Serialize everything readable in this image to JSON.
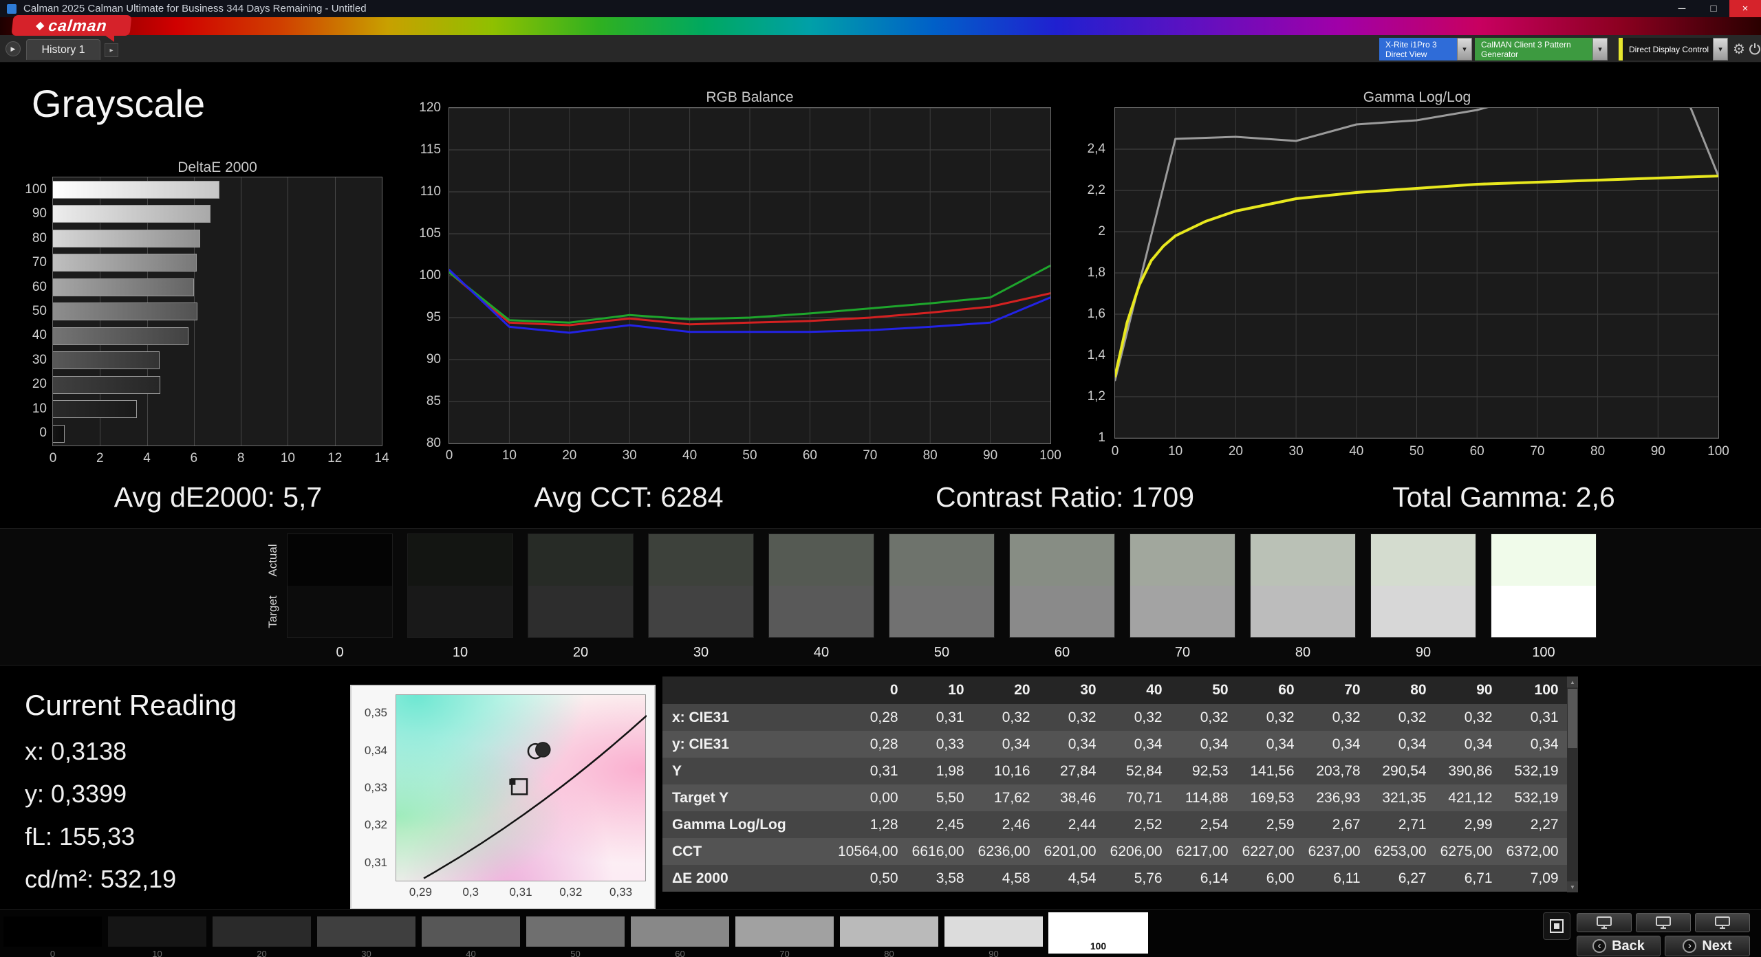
{
  "window": {
    "title": "Calman 2025 Calman Ultimate for Business 344 Days Remaining  - Untitled",
    "minimize": "─",
    "maximize": "□",
    "close": "×"
  },
  "brand": {
    "name": "calman",
    "diamond": "◆"
  },
  "toolbar": {
    "tab": "History 1",
    "meter_line1": "X-Rite i1Pro 3",
    "meter_line2": "Direct View",
    "generator_label": "CalMAN Client 3 Pattern Generator",
    "display_label": "Direct Display Control"
  },
  "page": {
    "title": "Grayscale"
  },
  "stats": {
    "de": "Avg dE2000: 5,7",
    "cct": "Avg CCT: 6284",
    "contrast": "Contrast Ratio: 1709",
    "gamma": "Total Gamma: 2,6"
  },
  "chart_data": [
    {
      "name": "deltae",
      "type": "bar",
      "title": "DeltaE 2000",
      "orientation": "horizontal",
      "categories": [
        100,
        90,
        80,
        70,
        60,
        50,
        40,
        30,
        20,
        10,
        0
      ],
      "values": [
        7.09,
        6.71,
        6.27,
        6.11,
        6.0,
        6.14,
        5.76,
        4.54,
        4.58,
        3.58,
        0.5
      ],
      "xlim": [
        0,
        14
      ],
      "xticks": [
        0,
        2,
        4,
        6,
        8,
        10,
        12,
        14
      ],
      "bar_fills": [
        [
          "#ffffff",
          "#c6c6c6"
        ],
        [
          "#ededed",
          "#a9a9a9"
        ],
        [
          "#d7d7d7",
          "#8f8f8f"
        ],
        [
          "#bfbfbf",
          "#787878"
        ],
        [
          "#a7a7a7",
          "#646464"
        ],
        [
          "#8e8e8e",
          "#525252"
        ],
        [
          "#747474",
          "#424242"
        ],
        [
          "#595959",
          "#333333"
        ],
        [
          "#404040",
          "#262626"
        ],
        [
          "#2a2a2a",
          "#191919"
        ],
        [
          "#151515",
          "#0d0d0d"
        ]
      ]
    },
    {
      "name": "rgb-balance",
      "type": "line",
      "title": "RGB Balance",
      "xlim": [
        0,
        100
      ],
      "xticks": [
        0,
        10,
        20,
        30,
        40,
        50,
        60,
        70,
        80,
        90,
        100
      ],
      "ylim": [
        80,
        120
      ],
      "yticks": [
        80,
        85,
        90,
        95,
        100,
        105,
        110,
        115,
        120
      ],
      "x": [
        0,
        10,
        20,
        30,
        40,
        50,
        60,
        70,
        80,
        90,
        100
      ],
      "series": [
        {
          "name": "Red",
          "color": "#d42121",
          "values": [
            100.4,
            94.4,
            94.1,
            94.9,
            94.2,
            94.4,
            94.6,
            95.0,
            95.6,
            96.3,
            97.9
          ]
        },
        {
          "name": "Green",
          "color": "#1ea62c",
          "values": [
            100.4,
            94.7,
            94.4,
            95.3,
            94.8,
            95.0,
            95.5,
            96.1,
            96.7,
            97.4,
            101.2
          ]
        },
        {
          "name": "Blue",
          "color": "#2323e6",
          "values": [
            100.7,
            93.9,
            93.2,
            94.1,
            93.3,
            93.3,
            93.3,
            93.5,
            93.9,
            94.4,
            97.4
          ]
        }
      ]
    },
    {
      "name": "gamma-loglog",
      "type": "line",
      "title": "Gamma Log/Log",
      "xlim": [
        0,
        100
      ],
      "xticks": [
        0,
        10,
        20,
        30,
        40,
        50,
        60,
        70,
        80,
        90,
        100
      ],
      "ylim": [
        1,
        2.6
      ],
      "ytick_vals": [
        1,
        1.2,
        1.4,
        1.6,
        1.8,
        2,
        2.2,
        2.4
      ],
      "ytick_labels": [
        "1",
        "1,2",
        "1,4",
        "1,6",
        "1,8",
        "2",
        "2,2",
        "2,4"
      ],
      "series": [
        {
          "name": "Measured",
          "color": "#9b9b9b",
          "width": 3,
          "x": [
            0,
            10,
            20,
            30,
            40,
            50,
            60,
            70,
            80,
            90,
            100
          ],
          "values": [
            1.28,
            2.45,
            2.46,
            2.44,
            2.52,
            2.54,
            2.59,
            2.67,
            2.71,
            2.99,
            2.27
          ]
        },
        {
          "name": "Average",
          "color": "#e8e81e",
          "width": 4,
          "x": [
            0,
            2,
            4,
            6,
            8,
            10,
            15,
            20,
            30,
            40,
            50,
            60,
            70,
            80,
            90,
            100
          ],
          "values": [
            1.3,
            1.56,
            1.74,
            1.86,
            1.93,
            1.98,
            2.05,
            2.1,
            2.16,
            2.19,
            2.21,
            2.23,
            2.24,
            2.25,
            2.26,
            2.27
          ]
        }
      ]
    }
  ],
  "swatches": {
    "actual_label": "Actual",
    "target_label": "Target",
    "steps": [
      {
        "label": "0",
        "actual": "#040404",
        "target": "#0c0c0c"
      },
      {
        "label": "10",
        "actual": "#131512",
        "target": "#191919"
      },
      {
        "label": "20",
        "actual": "#272b26",
        "target": "#2d2d2d"
      },
      {
        "label": "30",
        "actual": "#3d413b",
        "target": "#424242"
      },
      {
        "label": "40",
        "actual": "#555a53",
        "target": "#595959"
      },
      {
        "label": "50",
        "actual": "#6e736c",
        "target": "#717171"
      },
      {
        "label": "60",
        "actual": "#878d84",
        "target": "#8a8a8a"
      },
      {
        "label": "70",
        "actual": "#a1a79d",
        "target": "#a3a3a3"
      },
      {
        "label": "80",
        "actual": "#bac1b6",
        "target": "#bcbcbc"
      },
      {
        "label": "90",
        "actual": "#d4dccf",
        "target": "#d7d7d7"
      },
      {
        "label": "100",
        "actual": "#f0fbea",
        "target": "#ffffff"
      }
    ]
  },
  "reading": {
    "title": "Current Reading",
    "lines": [
      "x: 0,3138",
      "y: 0,3399",
      "fL: 155,33",
      "cd/m²: 532,19"
    ]
  },
  "cie": {
    "xrange": [
      0.285,
      0.335
    ],
    "yrange": [
      0.305,
      0.355
    ],
    "xtick_vals": [
      0.29,
      0.3,
      0.31,
      0.32,
      0.33
    ],
    "xtick_labels": [
      "0,29",
      "0,3",
      "0,31",
      "0,32",
      "0,33"
    ],
    "ytick_vals": [
      0.35,
      0.34,
      0.33,
      0.32,
      0.31
    ],
    "ytick_labels": [
      "0,35",
      "0,34",
      "0,33",
      "0,32",
      "0,31"
    ],
    "locus": {
      "start": [
        0.2905,
        0.306
      ],
      "control": [
        0.3135,
        0.3235
      ],
      "end": [
        0.335,
        0.3495
      ]
    },
    "markers": [
      {
        "type": "square-open",
        "x": 0.3096,
        "y": 0.3305
      },
      {
        "type": "square-filled",
        "x": 0.3082,
        "y": 0.3318
      },
      {
        "type": "circle-open",
        "x": 0.3128,
        "y": 0.34
      },
      {
        "type": "circle-filled",
        "x": 0.3143,
        "y": 0.3404
      }
    ]
  },
  "table": {
    "columns": [
      "0",
      "10",
      "20",
      "30",
      "40",
      "50",
      "60",
      "70",
      "80",
      "90",
      "100"
    ],
    "rows": [
      {
        "label": "x: CIE31",
        "values": [
          "0,28",
          "0,31",
          "0,32",
          "0,32",
          "0,32",
          "0,32",
          "0,32",
          "0,32",
          "0,32",
          "0,32",
          "0,31"
        ]
      },
      {
        "label": "y: CIE31",
        "values": [
          "0,28",
          "0,33",
          "0,34",
          "0,34",
          "0,34",
          "0,34",
          "0,34",
          "0,34",
          "0,34",
          "0,34",
          "0,34"
        ]
      },
      {
        "label": "Y",
        "values": [
          "0,31",
          "1,98",
          "10,16",
          "27,84",
          "52,84",
          "92,53",
          "141,56",
          "203,78",
          "290,54",
          "390,86",
          "532,19"
        ]
      },
      {
        "label": "Target Y",
        "values": [
          "0,00",
          "5,50",
          "17,62",
          "38,46",
          "70,71",
          "114,88",
          "169,53",
          "236,93",
          "321,35",
          "421,12",
          "532,19"
        ]
      },
      {
        "label": "Gamma Log/Log",
        "values": [
          "1,28",
          "2,45",
          "2,46",
          "2,44",
          "2,52",
          "2,54",
          "2,59",
          "2,67",
          "2,71",
          "2,99",
          "2,27"
        ]
      },
      {
        "label": "CCT",
        "values": [
          "10564,00",
          "6616,00",
          "6236,00",
          "6201,00",
          "6206,00",
          "6217,00",
          "6227,00",
          "6237,00",
          "6253,00",
          "6275,00",
          "6372,00"
        ]
      },
      {
        "label": "ΔE 2000",
        "values": [
          "0,50",
          "3,58",
          "4,58",
          "4,54",
          "5,76",
          "6,14",
          "6,00",
          "6,11",
          "6,27",
          "6,71",
          "7,09"
        ]
      }
    ]
  },
  "pattern_bar": {
    "back": "Back",
    "next": "Next",
    "patches": [
      {
        "label": "0",
        "color": "#000000"
      },
      {
        "label": "10",
        "color": "#151515"
      },
      {
        "label": "20",
        "color": "#2a2a2a"
      },
      {
        "label": "30",
        "color": "#3f3f3f"
      },
      {
        "label": "40",
        "color": "#575757"
      },
      {
        "label": "50",
        "color": "#6f6f6f"
      },
      {
        "label": "60",
        "color": "#888888"
      },
      {
        "label": "70",
        "color": "#a1a1a1"
      },
      {
        "label": "80",
        "color": "#bababa"
      },
      {
        "label": "90",
        "color": "#dcdcdc"
      },
      {
        "label": "100",
        "color": "#ffffff",
        "selected": true
      }
    ]
  }
}
